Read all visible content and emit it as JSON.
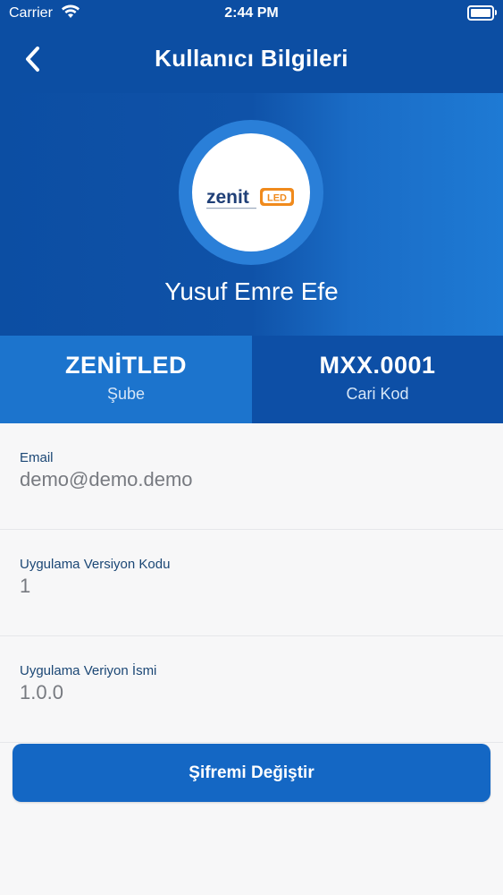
{
  "status_bar": {
    "carrier": "Carrier",
    "time": "2:44 PM"
  },
  "nav": {
    "title": "Kullanıcı Bilgileri",
    "back_icon": "chevron-left-icon"
  },
  "profile": {
    "logo_text": "zenit",
    "logo_badge": "LED",
    "name": "Yusuf Emre Efe"
  },
  "stats": [
    {
      "value": "ZENİTLED",
      "label": "Şube"
    },
    {
      "value": "MXX.0001",
      "label": "Cari Kod"
    }
  ],
  "fields": [
    {
      "label": "Email",
      "value": "demo@demo.demo"
    },
    {
      "label": "Uygulama Versiyon Kodu",
      "value": "1"
    },
    {
      "label": "Uygulama Veriyon İsmi",
      "value": "1.0.0"
    }
  ],
  "actions": {
    "change_password_label": "Şifremi Değiştir"
  },
  "colors": {
    "primary": "#0d4fa6",
    "accent": "#1c74cd",
    "button": "#1467c4",
    "logo_orange": "#f08a1c"
  }
}
